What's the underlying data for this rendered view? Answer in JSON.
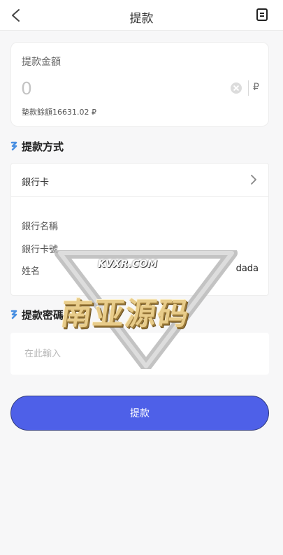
{
  "header": {
    "title": "提款",
    "back_icon": "chevron-left-icon",
    "record_icon": "document-list-icon"
  },
  "amount": {
    "label": "提款金額",
    "placeholder": "0",
    "currency": "₽",
    "balance_text": "墊款餘額16631.02 ₽"
  },
  "method_section": {
    "title": "提款方式",
    "bank_card_label": "銀行卡",
    "bank_name_label": "銀行名稱",
    "bank_card_no_label": "銀行卡號",
    "name_label": "姓名",
    "name_value": "dada"
  },
  "password_section": {
    "title": "提款密碼",
    "placeholder": "在此輸入"
  },
  "submit": {
    "label": "提款"
  },
  "watermark": {
    "small_text": "KVXR.COM",
    "big_text": "南亚源码"
  },
  "colors": {
    "accent": "#4e60e8",
    "section_mark": "#4a90e2"
  }
}
